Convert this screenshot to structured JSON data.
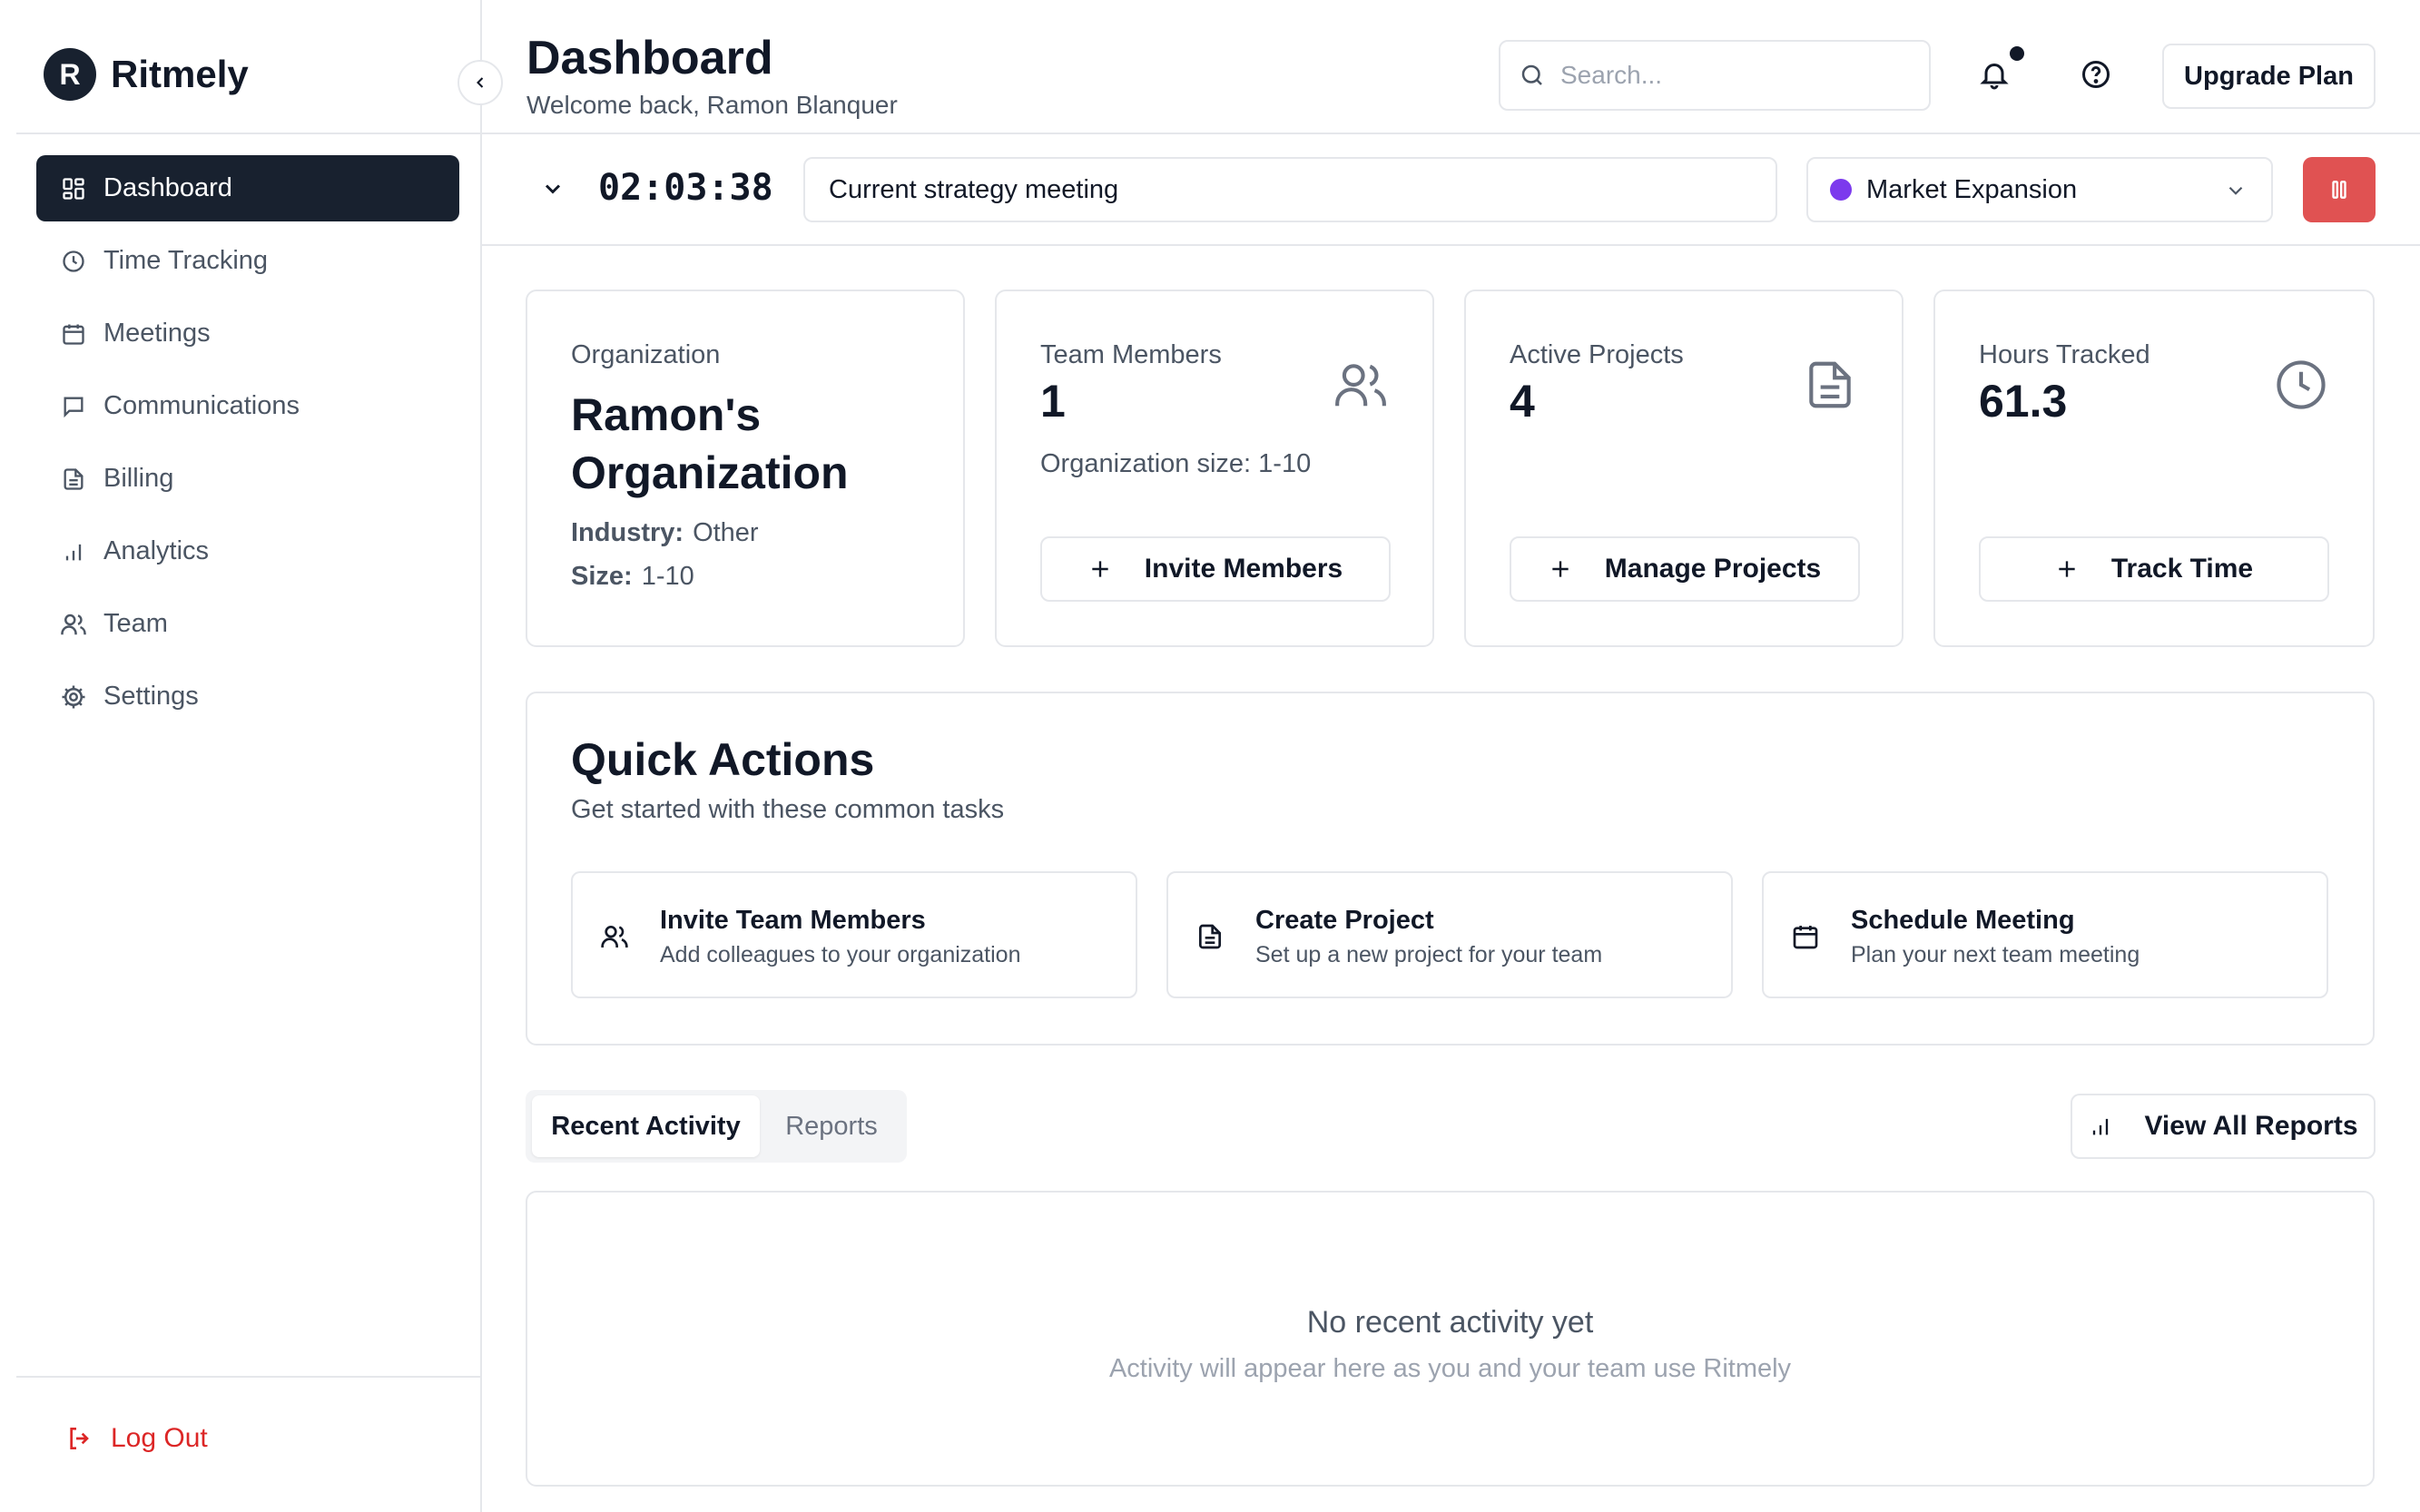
{
  "brand": {
    "logo_letter": "R",
    "name": "Ritmely"
  },
  "sidebar": {
    "items": [
      {
        "label": "Dashboard",
        "icon": "dashboard-grid-icon",
        "active": true
      },
      {
        "label": "Time Tracking",
        "icon": "clock-icon",
        "active": false
      },
      {
        "label": "Meetings",
        "icon": "calendar-icon",
        "active": false
      },
      {
        "label": "Communications",
        "icon": "message-icon",
        "active": false
      },
      {
        "label": "Billing",
        "icon": "file-text-icon",
        "active": false
      },
      {
        "label": "Analytics",
        "icon": "bar-chart-icon",
        "active": false
      },
      {
        "label": "Team",
        "icon": "users-icon",
        "active": false
      },
      {
        "label": "Settings",
        "icon": "gear-icon",
        "active": false
      }
    ],
    "logout_label": "Log Out"
  },
  "header": {
    "title": "Dashboard",
    "subtitle": "Welcome back, Ramon Blanquer",
    "search_placeholder": "Search...",
    "upgrade_label": "Upgrade Plan"
  },
  "timer": {
    "elapsed": "02:03:38",
    "description": "Current strategy meeting",
    "project": "Market Expansion",
    "project_color": "#7c3aed",
    "stop_color": "#e05252"
  },
  "stats": {
    "organization": {
      "label": "Organization",
      "name": "Ramon's Organization",
      "industry_label": "Industry:",
      "industry": "Other",
      "size_label": "Size:",
      "size": "1-10"
    },
    "team_members": {
      "label": "Team Members",
      "value": "1",
      "note": "Organization size: 1-10",
      "button": "Invite Members"
    },
    "active_projects": {
      "label": "Active Projects",
      "value": "4",
      "button": "Manage Projects"
    },
    "hours_tracked": {
      "label": "Hours Tracked",
      "value": "61.3",
      "button": "Track Time"
    }
  },
  "quick_actions": {
    "title": "Quick Actions",
    "subtitle": "Get started with these common tasks",
    "items": [
      {
        "title": "Invite Team Members",
        "description": "Add colleagues to your organization",
        "icon": "users-icon"
      },
      {
        "title": "Create Project",
        "description": "Set up a new project for your team",
        "icon": "file-text-icon"
      },
      {
        "title": "Schedule Meeting",
        "description": "Plan your next team meeting",
        "icon": "calendar-icon"
      }
    ]
  },
  "activity": {
    "tabs": [
      "Recent Activity",
      "Reports"
    ],
    "active_tab": "Recent Activity",
    "view_reports_label": "View All Reports",
    "empty_title": "No recent activity yet",
    "empty_subtitle": "Activity will appear here as you and your team use Ritmely"
  }
}
